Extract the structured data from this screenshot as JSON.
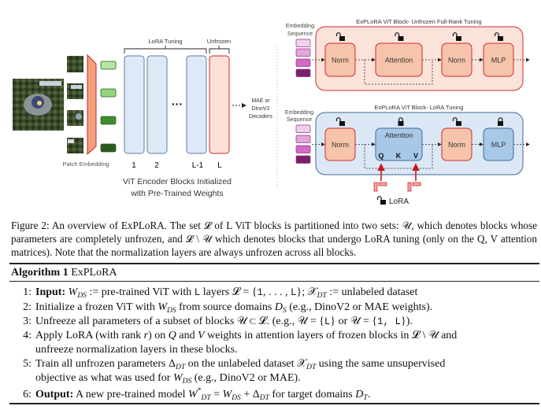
{
  "figure": {
    "left": {
      "lora_tuning_label": "LoRA Tuning",
      "unfrozen_label": "Unfrozen",
      "patch_embedding_label": "Patch Embedding",
      "block_labels": [
        "1",
        "2",
        "L-1",
        "L"
      ],
      "encoder_title_line1": "ViT Encoder Blocks Initialized",
      "encoder_title_line2": "with Pre-Trained Weights",
      "decoder_label": [
        "MAE or",
        "DinoV2",
        "Decoders"
      ],
      "token_colors": [
        "#b7e3a3",
        "#8fd67a",
        "#3f8c2c",
        "#2b5a1f"
      ],
      "lora_block_color": "#dde9f5",
      "unfrozen_block_color": "#fce0d6"
    },
    "top_block": {
      "title": "ExPLoRA ViT Block- Unfrozen Full-Rank Tuning",
      "embedding_label": [
        "Embedding",
        "Sequence"
      ],
      "modules": [
        {
          "label": "Norm",
          "lock": "unlocked"
        },
        {
          "label": "Attention",
          "lock": "unlocked"
        },
        {
          "label": "Norm",
          "lock": "unlocked"
        },
        {
          "label": "MLP",
          "lock": "unlocked"
        }
      ]
    },
    "bottom_block": {
      "title": "ExPLoRA ViT Block- LoRA Tuning",
      "embedding_label": [
        "Embedding",
        "Sequence"
      ],
      "modules": [
        {
          "label": "Norm",
          "lock": "unlocked"
        },
        {
          "label": "Attention",
          "lock": "locked"
        },
        {
          "label": "Norm",
          "lock": "unlocked"
        },
        {
          "label": "MLP",
          "lock": "locked"
        }
      ],
      "qkv": [
        "Q",
        "K",
        "V"
      ],
      "lora_legend": "LoRA"
    },
    "embedding_token_colors": [
      "#f1d0ec",
      "#e4a5dc",
      "#d468c9",
      "#7b1f6b"
    ]
  },
  "caption": "Figure 2: An overview of ExPLoRA. The set 𝓛 of L ViT blocks is partitioned into two sets: 𝒰, which denotes blocks whose parameters are completely unfrozen, and 𝓛 \\ 𝒰 which denotes blocks that undergo LoRA tuning (only on the Q, V attention matrices). Note that the normalization layers are always unfrozen across all blocks.",
  "algorithm": {
    "label": "Algorithm 1",
    "name": "ExPLoRA",
    "lines": [
      {
        "num": "1:",
        "segs": [
          [
            "b",
            "Input:"
          ],
          [
            "t",
            " "
          ],
          [
            "i",
            "W"
          ],
          [
            "sub",
            "DS"
          ],
          [
            "t",
            " := pre-trained ViT with "
          ],
          [
            "mono",
            "L"
          ],
          [
            "t",
            " layers 𝓛 = {"
          ],
          [
            "mono",
            "1"
          ],
          [
            "t",
            ", . . . , "
          ],
          [
            "mono",
            "L"
          ],
          [
            "t",
            "}; 𝒳"
          ],
          [
            "sub",
            "DT"
          ],
          [
            "t",
            " := unlabeled dataset"
          ]
        ]
      },
      {
        "num": "2:",
        "segs": [
          [
            "t",
            "Initialize a frozen ViT with "
          ],
          [
            "i",
            "W"
          ],
          [
            "sub",
            "DS"
          ],
          [
            "t",
            " from source domains "
          ],
          [
            "i",
            "D"
          ],
          [
            "sub",
            "S"
          ],
          [
            "t",
            " (e.g., DinoV2 or MAE weights)."
          ]
        ]
      },
      {
        "num": "3:",
        "segs": [
          [
            "t",
            "Unfreeze all parameters of a subset of blocks 𝒰 ⊂ 𝓛. (e.g., 𝒰 = {"
          ],
          [
            "mono",
            "L"
          ],
          [
            "t",
            "} or 𝒰 = {"
          ],
          [
            "mono",
            "1, L"
          ],
          [
            "t",
            "})."
          ]
        ]
      },
      {
        "num": "4:",
        "segs": [
          [
            "t",
            "Apply LoRA (with rank "
          ],
          [
            "i",
            "r"
          ],
          [
            "t",
            ") on "
          ],
          [
            "i",
            "Q"
          ],
          [
            "t",
            " and "
          ],
          [
            "i",
            "V"
          ],
          [
            "t",
            " weights in attention layers of frozen blocks in 𝓛 \\ 𝒰 and"
          ]
        ]
      },
      {
        "num": "",
        "segs": [
          [
            "t",
            "unfreeze normalization layers in these blocks."
          ]
        ]
      },
      {
        "num": "5:",
        "segs": [
          [
            "t",
            "Train all unfrozen parameters Δ"
          ],
          [
            "sub",
            "DT"
          ],
          [
            "t",
            " on the unlabeled dataset 𝒳"
          ],
          [
            "sub",
            "DT"
          ],
          [
            "t",
            " using the same unsupervised"
          ]
        ]
      },
      {
        "num": "",
        "segs": [
          [
            "t",
            "objective as what was used for "
          ],
          [
            "i",
            "W"
          ],
          [
            "sub",
            "DS"
          ],
          [
            "t",
            " (e.g., DinoV2 or MAE)."
          ]
        ]
      },
      {
        "num": "6:",
        "segs": [
          [
            "b",
            "Output:"
          ],
          [
            "t",
            " A new pre-trained model "
          ],
          [
            "i",
            "W"
          ],
          [
            "sup",
            "*"
          ],
          [
            "sub",
            "DT"
          ],
          [
            "t",
            " = "
          ],
          [
            "i",
            "W"
          ],
          [
            "sub",
            "DS"
          ],
          [
            "t",
            " + Δ"
          ],
          [
            "sub",
            "DT"
          ],
          [
            "t",
            " for target domains "
          ],
          [
            "i",
            "D"
          ],
          [
            "sub",
            "T"
          ],
          [
            "t",
            "."
          ]
        ]
      }
    ]
  }
}
